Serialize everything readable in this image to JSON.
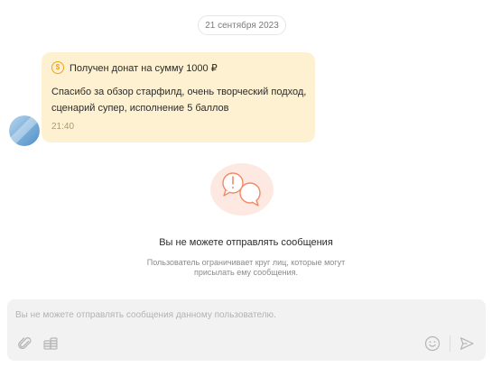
{
  "chat": {
    "date": "21 сентября 2023",
    "message": {
      "donation_currency_symbol": "$",
      "donation_title": "Получен донат на сумму 1000 ₽",
      "text": "Спасибо за обзор старфилд, очень творческий подход, сценарий супер, исполнение 5 баллов",
      "time": "21:40"
    }
  },
  "notice": {
    "title": "Вы не можете отправлять сообщения",
    "subtitle": "Пользователь ограничивает круг лиц, которые могут присылать ему сообщения."
  },
  "composer": {
    "placeholder": "Вы не можете отправлять сообщения данному пользователю."
  },
  "icons": {
    "attach": "paperclip-icon",
    "donate": "coins-icon",
    "emoji": "smiley-icon",
    "send": "send-icon",
    "notice": "chat-warning-icon"
  },
  "colors": {
    "bubble_bg": "#fdf1d1",
    "accent": "#f0a21a",
    "notice_bg": "#fde9e1",
    "notice_stroke": "#f08a68"
  }
}
